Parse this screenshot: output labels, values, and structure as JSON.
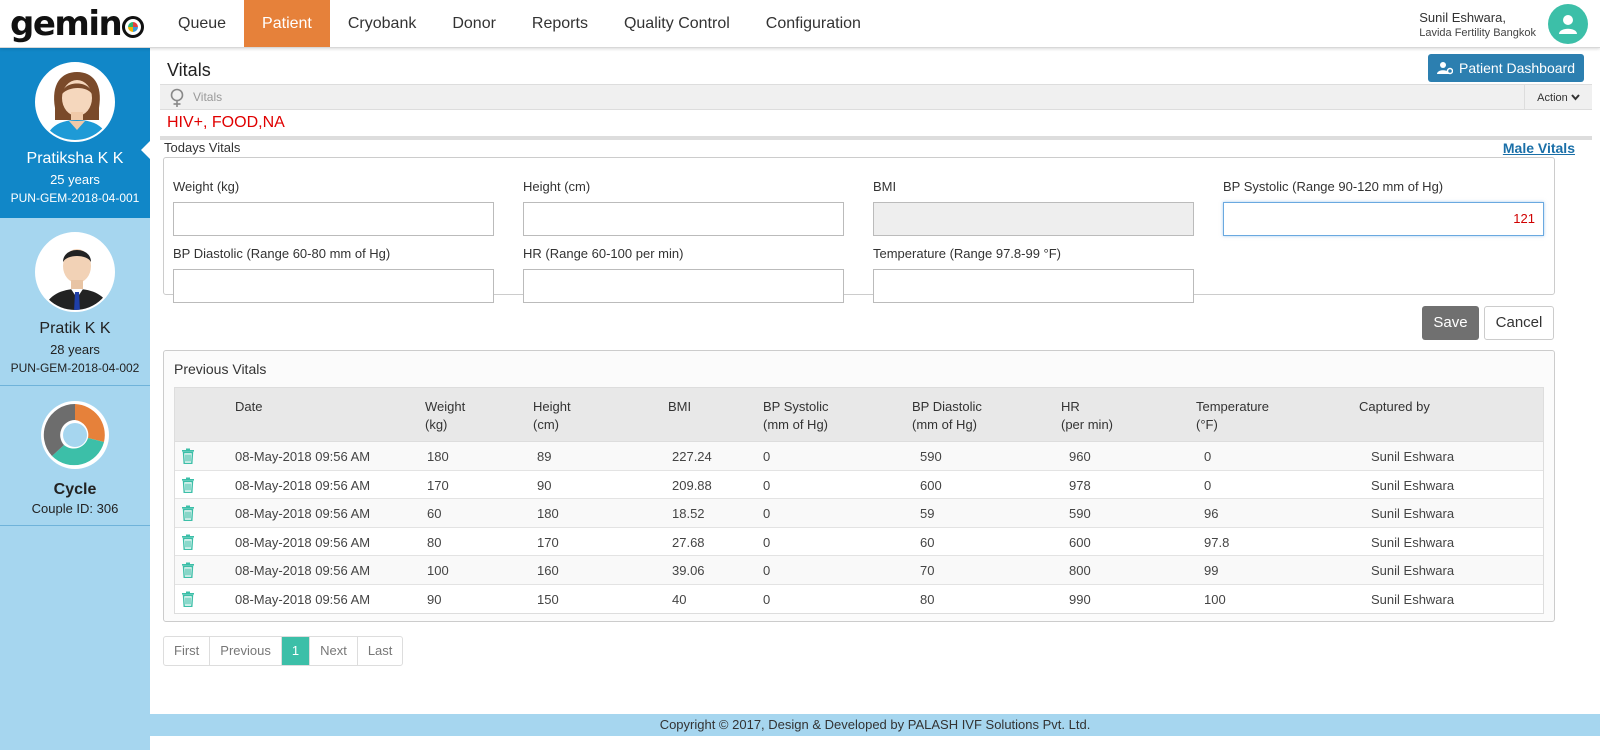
{
  "app": {
    "logo_text": "gemin"
  },
  "nav": {
    "items": [
      {
        "label": "Queue"
      },
      {
        "label": "Patient",
        "active": true
      },
      {
        "label": "Cryobank"
      },
      {
        "label": "Donor"
      },
      {
        "label": "Reports"
      },
      {
        "label": "Quality Control"
      },
      {
        "label": "Configuration"
      }
    ]
  },
  "user": {
    "name": "Sunil Eshwara,",
    "org": "Lavida Fertility Bangkok"
  },
  "sidebar": {
    "female": {
      "name": "Pratiksha K K",
      "age": "25 years",
      "id": "PUN-GEM-2018-04-001"
    },
    "male": {
      "name": "Pratik K K",
      "age": "28 years",
      "id": "PUN-GEM-2018-04-002"
    },
    "cycle": {
      "title": "Cycle",
      "couple_id": "Couple ID: 306"
    }
  },
  "page": {
    "title": "Vitals",
    "dashboard_button": "Patient Dashboard",
    "breadcrumb": "Vitals",
    "action_label": "Action",
    "alerts": "HIV+, FOOD,NA",
    "todays_label": "Todays Vitals",
    "male_vitals_link": "Male Vitals"
  },
  "form": {
    "weight_label": "Weight (kg)",
    "weight_value": "",
    "height_label": "Height (cm)",
    "height_value": "",
    "bmi_label": "BMI",
    "bmi_value": "",
    "bps_label": "BP Systolic (Range 90-120 mm of Hg)",
    "bps_value": "121",
    "bpd_label": "BP Diastolic (Range 60-80 mm of Hg)",
    "bpd_value": "",
    "hr_label": "HR (Range 60-100 per min)",
    "hr_value": "",
    "temp_label": "Temperature (Range 97.8-99 °F)",
    "temp_value": "",
    "save_label": "Save",
    "cancel_label": "Cancel"
  },
  "previous": {
    "title": "Previous Vitals",
    "headers": [
      "Date",
      "Weight\n(kg)",
      "Height\n(cm)",
      "BMI",
      "BP Systolic\n(mm of Hg)",
      "BP Diastolic\n(mm of Hg)",
      "HR\n(per min)",
      "Temperature\n(°F)",
      "Captured by"
    ],
    "rows": [
      [
        "08-May-2018 09:56 AM",
        "180",
        "89",
        "227.24",
        "0",
        "590",
        "960",
        "0",
        "Sunil Eshwara"
      ],
      [
        "08-May-2018 09:56 AM",
        "170",
        "90",
        "209.88",
        "0",
        "600",
        "978",
        "0",
        "Sunil Eshwara"
      ],
      [
        "08-May-2018 09:56 AM",
        "60",
        "180",
        "18.52",
        "0",
        "59",
        "590",
        "96",
        "Sunil Eshwara"
      ],
      [
        "08-May-2018 09:56 AM",
        "80",
        "170",
        "27.68",
        "0",
        "60",
        "600",
        "97.8",
        "Sunil Eshwara"
      ],
      [
        "08-May-2018 09:56 AM",
        "100",
        "160",
        "39.06",
        "0",
        "70",
        "800",
        "99",
        "Sunil Eshwara"
      ],
      [
        "08-May-2018 09:56 AM",
        "90",
        "150",
        "40",
        "0",
        "80",
        "990",
        "100",
        "Sunil Eshwara"
      ]
    ]
  },
  "pagination": {
    "first": "First",
    "previous": "Previous",
    "current": "1",
    "next": "Next",
    "last": "Last"
  },
  "footer": "Copyright © 2017, Design & Developed by PALASH IVF Solutions Pvt. Ltd.",
  "colors": {
    "active_nav": "#e6813a",
    "sidebar_active": "#1187c8",
    "sidebar_bg": "#a6d6ef",
    "accent": "#3cbfa8",
    "primary_button": "#2c7fb0",
    "alert": "#e00000"
  },
  "icons": {
    "trash": "trash-icon",
    "female": "female-symbol-icon",
    "user": "user-icon",
    "dashboard": "user-cog-icon",
    "chevron": "chevron-down-icon"
  }
}
